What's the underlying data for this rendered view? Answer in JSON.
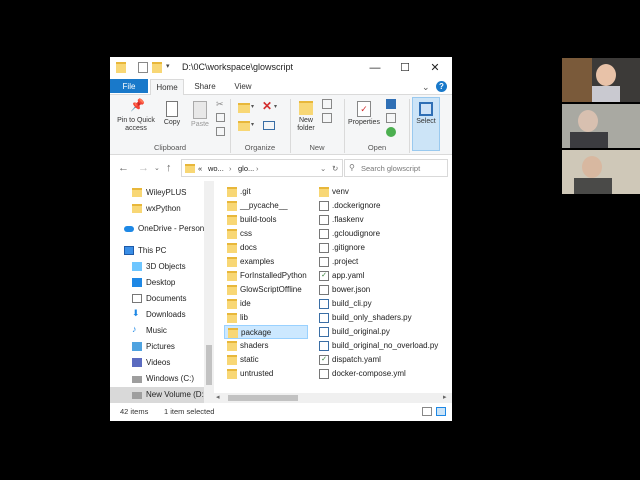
{
  "window": {
    "path_title": "D:\\0C\\workspace\\glowscript",
    "minimize": "—",
    "maximize": "☐",
    "close": "✕"
  },
  "tabs": [
    {
      "label": "File"
    },
    {
      "label": "Home"
    },
    {
      "label": "Share"
    },
    {
      "label": "View"
    }
  ],
  "help": "?",
  "ribbon": {
    "pin_label": "Pin to Quick access",
    "copy_label": "Copy",
    "paste_label": "Paste",
    "clipboard_group": "Clipboard",
    "organize_group": "Organize",
    "new_folder_label": "New folder",
    "new_group": "New",
    "properties_label": "Properties",
    "open_group": "Open",
    "select_label": "Select"
  },
  "address": {
    "overflow": "«",
    "crumbs": [
      "wo...",
      "glo..."
    ],
    "search_placeholder": "Search glowscript"
  },
  "nav": {
    "items": [
      {
        "label": "WileyPLUS"
      },
      {
        "label": "wxPython"
      },
      {
        "label": "OneDrive - Person"
      },
      {
        "label": "This PC"
      },
      {
        "label": "3D Objects"
      },
      {
        "label": "Desktop"
      },
      {
        "label": "Documents"
      },
      {
        "label": "Downloads"
      },
      {
        "label": "Music"
      },
      {
        "label": "Pictures"
      },
      {
        "label": "Videos"
      },
      {
        "label": "Windows (C:)"
      },
      {
        "label": "New Volume (D:)"
      }
    ]
  },
  "files": {
    "col1": [
      {
        "name": ".git"
      },
      {
        "name": "__pycache__"
      },
      {
        "name": "build-tools"
      },
      {
        "name": "css"
      },
      {
        "name": "docs"
      },
      {
        "name": "examples"
      },
      {
        "name": "ForInstalledPython"
      },
      {
        "name": "GlowScriptOffline"
      },
      {
        "name": "ide"
      },
      {
        "name": "lib"
      },
      {
        "name": "package"
      },
      {
        "name": "shaders"
      },
      {
        "name": "static"
      },
      {
        "name": "untrusted"
      }
    ],
    "col2": [
      {
        "name": "venv"
      },
      {
        "name": ".dockerignore"
      },
      {
        "name": ".flaskenv"
      },
      {
        "name": ".gcloudignore"
      },
      {
        "name": ".gitignore"
      },
      {
        "name": ".project"
      },
      {
        "name": "app.yaml"
      },
      {
        "name": "bower.json"
      },
      {
        "name": "build_cli.py"
      },
      {
        "name": "build_only_shaders.py"
      },
      {
        "name": "build_original.py"
      },
      {
        "name": "build_original_no_overload.py"
      },
      {
        "name": "dispatch.yaml"
      },
      {
        "name": "docker-compose.yml"
      }
    ]
  },
  "status": {
    "count": "42 items",
    "selected": "1 item selected"
  }
}
